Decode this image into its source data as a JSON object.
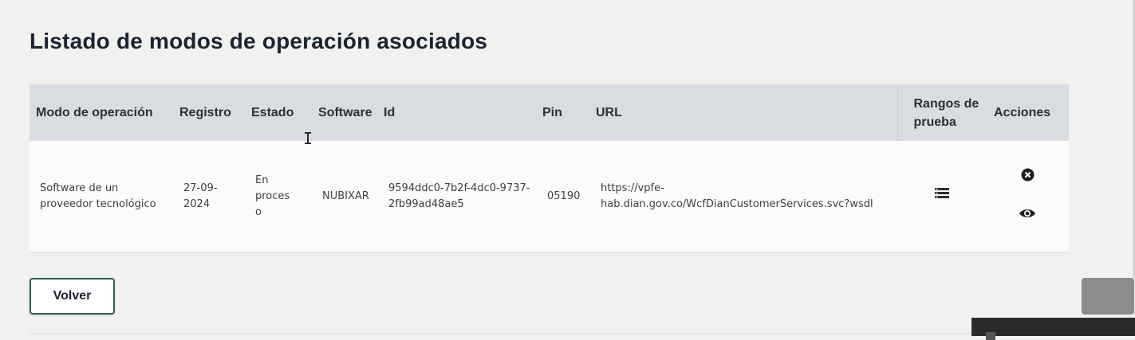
{
  "page": {
    "title": "Listado de modos de operación asociados"
  },
  "table": {
    "headers": {
      "mode": "Modo de operación",
      "registro": "Registro",
      "estado": "Estado",
      "software": "Software",
      "id": "Id",
      "pin": "Pin",
      "url": "URL",
      "rangos": "Rangos de prueba",
      "acciones": "Acciones"
    },
    "rows": [
      {
        "mode": "Software de un proveedor tecnológico",
        "registro": "27-09-2024",
        "estado": "En proceso",
        "software": "NUBIXAR",
        "id": "9594ddc0-7b2f-4dc0-9737-2fb99ad48ae5",
        "pin": "05190",
        "url": "https://vpfe-hab.dian.gov.co/WcfDianCustomerServices.svc?wsdl"
      }
    ]
  },
  "icons": {
    "rangos": "list-icon",
    "delete": "close-circle-icon",
    "view": "eye-icon"
  },
  "buttons": {
    "back_label": "Volver"
  },
  "colors": {
    "header_bg": "#d9dde2",
    "row_bg": "#fbfbfa",
    "page_bg": "#f1f1ef",
    "button_border": "#2e5c55"
  }
}
